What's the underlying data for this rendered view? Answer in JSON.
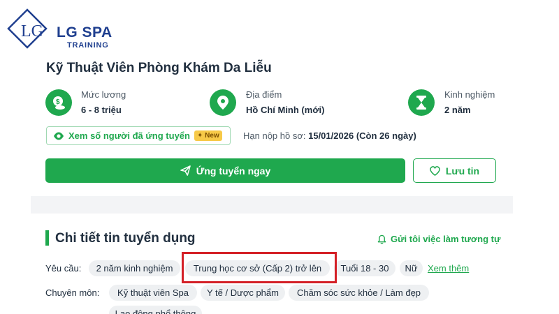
{
  "brand": {
    "name": "LG SPA",
    "tagline": "TRAINING",
    "mark_letters": "LG",
    "color": "#1f3f8f"
  },
  "job": {
    "title": "Kỹ Thuật Viên Phòng Khám Da Liễu",
    "salary": {
      "label": "Mức lương",
      "value": "6 - 8 triệu",
      "icon": "money-icon"
    },
    "location": {
      "label": "Địa điểm",
      "value": "Hồ Chí Minh (mới)",
      "icon": "location-pin-icon"
    },
    "experience": {
      "label": "Kinh nghiệm",
      "value": "2 năm",
      "icon": "hourglass-icon"
    },
    "view_applicants": {
      "label": "Xem số người đã ứng tuyển",
      "badge": "New",
      "icon": "eye-icon"
    },
    "deadline": {
      "label": "Hạn nộp hồ sơ:",
      "date": "15/01/2026",
      "remaining_prefix": "(Còn",
      "remaining_days": "26",
      "remaining_suffix": "ngày)"
    },
    "apply_label": "Ứng tuyển ngay",
    "save_label": "Lưu tin"
  },
  "details": {
    "title": "Chi tiết tin tuyển dụng",
    "notify_label": "Gửi tôi việc làm tương tự",
    "requirements": {
      "label": "Yêu cầu:",
      "chips": [
        "2 năm kinh nghiệm",
        "Trung học cơ sở (Cấp 2) trở lên",
        "Tuổi 18 - 30",
        "Nữ"
      ],
      "see_more": "Xem thêm"
    },
    "specialty": {
      "label": "Chuyên môn:",
      "chips": [
        "Kỹ thuật viên Spa",
        "Y tế / Dược phẩm",
        "Chăm sóc sức khỏe / Làm đẹp",
        "Lao động phổ thông"
      ]
    }
  },
  "colors": {
    "accent": "#1fa84e",
    "highlight": "#d42027",
    "new_badge": "#f7c948"
  }
}
